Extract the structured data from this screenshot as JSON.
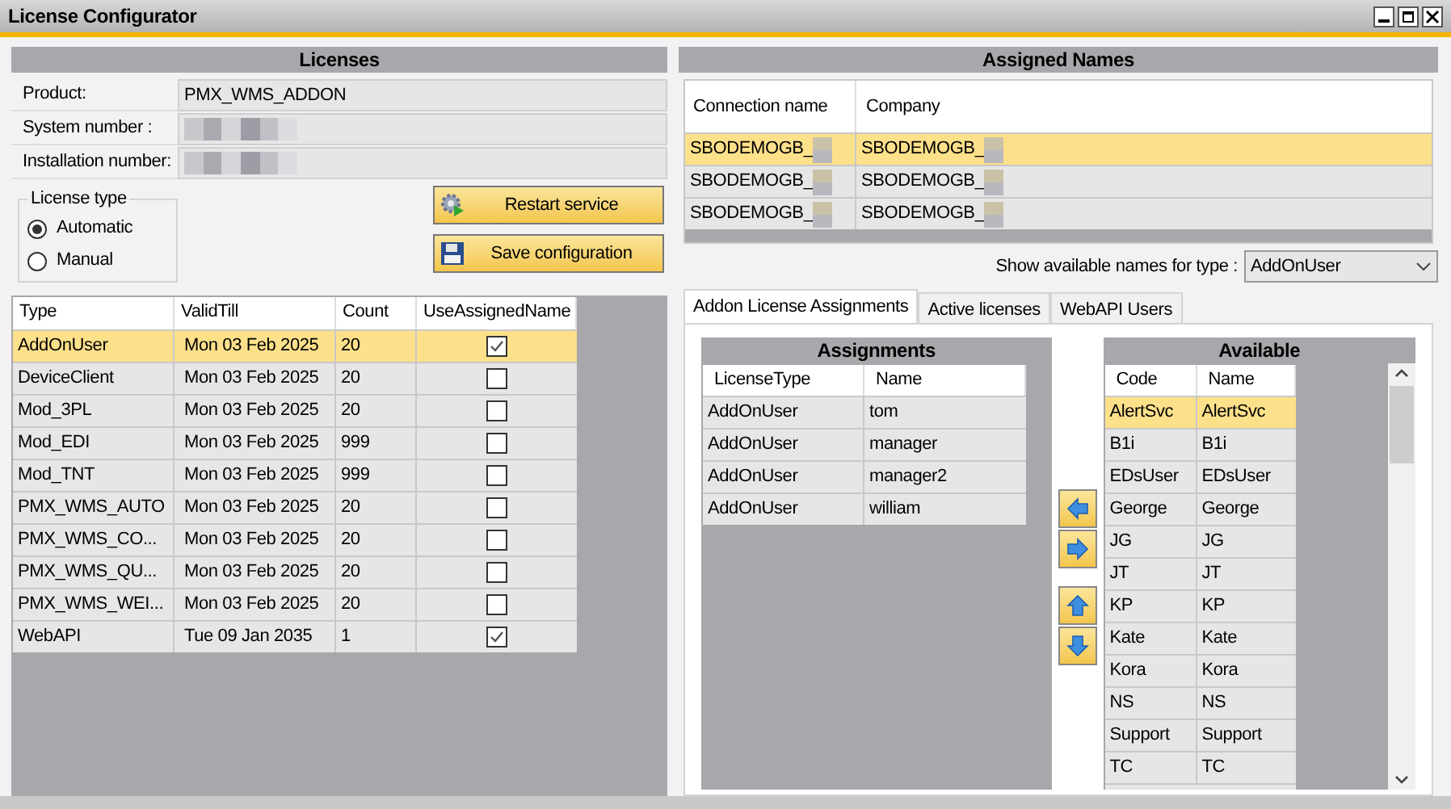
{
  "window": {
    "title": "License Configurator"
  },
  "licenses": {
    "header": "Licenses",
    "fields": [
      {
        "label": "Product:",
        "value": "PMX_WMS_ADDON"
      },
      {
        "label": "System number :"
      },
      {
        "label": "Installation number:"
      }
    ],
    "license_type": {
      "title": "License type",
      "options": [
        {
          "label": "Automatic",
          "selected": true
        },
        {
          "label": "Manual",
          "selected": false
        }
      ]
    },
    "buttons": [
      {
        "label": "Restart service",
        "kind": "restart"
      },
      {
        "label": "Save configuration",
        "kind": "save"
      }
    ],
    "table": {
      "columns": [
        "Type",
        "ValidTill",
        "Count",
        "UseAssignedName"
      ],
      "rows": [
        {
          "type": "AddOnUser",
          "valid_till": "Mon 03 Feb 2025",
          "count": "20",
          "use_assigned_name": true,
          "selected": true
        },
        {
          "type": "DeviceClient",
          "valid_till": "Mon 03 Feb 2025",
          "count": "20",
          "use_assigned_name": false,
          "selected": false
        },
        {
          "type": "Mod_3PL",
          "valid_till": "Mon 03 Feb 2025",
          "count": "20",
          "use_assigned_name": false,
          "selected": false
        },
        {
          "type": "Mod_EDI",
          "valid_till": "Mon 03 Feb 2025",
          "count": "999",
          "use_assigned_name": false,
          "selected": false
        },
        {
          "type": "Mod_TNT",
          "valid_till": "Mon 03 Feb 2025",
          "count": "999",
          "use_assigned_name": false,
          "selected": false
        },
        {
          "type": "PMX_WMS_AUTO",
          "valid_till": "Mon 03 Feb 2025",
          "count": "20",
          "use_assigned_name": false,
          "selected": false
        },
        {
          "type": "PMX_WMS_CO...",
          "valid_till": "Mon 03 Feb 2025",
          "count": "20",
          "use_assigned_name": false,
          "selected": false
        },
        {
          "type": "PMX_WMS_QU...",
          "valid_till": "Mon 03 Feb 2025",
          "count": "20",
          "use_assigned_name": false,
          "selected": false
        },
        {
          "type": "PMX_WMS_WEI...",
          "valid_till": "Mon 03 Feb 2025",
          "count": "20",
          "use_assigned_name": false,
          "selected": false
        },
        {
          "type": "WebAPI",
          "valid_till": "Tue 09 Jan 2035",
          "count": "1",
          "use_assigned_name": true,
          "selected": false
        }
      ]
    }
  },
  "assigned_names": {
    "header": "Assigned Names",
    "columns": [
      "Connection name",
      "Company"
    ],
    "rows": [
      {
        "connection": "SBODEMOGB_",
        "company": "SBODEMOGB_",
        "selected": true
      },
      {
        "connection": "SBODEMOGB_",
        "company": "SBODEMOGB_",
        "selected": false
      },
      {
        "connection": "SBODEMOGB_",
        "company": "SBODEMOGB_",
        "selected": false
      }
    ],
    "type_filter": {
      "label": "Show available names for type :",
      "value": "AddOnUser"
    },
    "tabs": [
      {
        "label": "Addon License Assignments",
        "selected": true
      },
      {
        "label": "Active licenses",
        "selected": false
      },
      {
        "label": "WebAPI Users",
        "selected": false
      }
    ],
    "assignments": {
      "header": "Assignments",
      "columns": [
        "LicenseType",
        "Name"
      ],
      "rows": [
        {
          "license_type": "AddOnUser",
          "name": "tom"
        },
        {
          "license_type": "AddOnUser",
          "name": "manager"
        },
        {
          "license_type": "AddOnUser",
          "name": "manager2"
        },
        {
          "license_type": "AddOnUser",
          "name": "william"
        }
      ]
    },
    "move_buttons": [
      {
        "kind": "left"
      },
      {
        "kind": "right"
      },
      {
        "kind": "up"
      },
      {
        "kind": "down"
      }
    ],
    "available": {
      "header": "Available",
      "columns": [
        "Code",
        "Name"
      ],
      "rows": [
        {
          "code": "AlertSvc",
          "name": "AlertSvc",
          "selected": true
        },
        {
          "code": "B1i",
          "name": "B1i",
          "selected": false
        },
        {
          "code": "EDsUser",
          "name": "EDsUser",
          "selected": false
        },
        {
          "code": "George",
          "name": "George",
          "selected": false
        },
        {
          "code": "JG",
          "name": "JG",
          "selected": false
        },
        {
          "code": "JT",
          "name": "JT",
          "selected": false
        },
        {
          "code": "KP",
          "name": "KP",
          "selected": false
        },
        {
          "code": "Kate",
          "name": "Kate",
          "selected": false
        },
        {
          "code": "Kora",
          "name": "Kora",
          "selected": false
        },
        {
          "code": "NS",
          "name": "NS",
          "selected": false
        },
        {
          "code": "Support",
          "name": "Support",
          "selected": false
        },
        {
          "code": "TC",
          "name": "TC",
          "selected": false
        }
      ]
    }
  }
}
